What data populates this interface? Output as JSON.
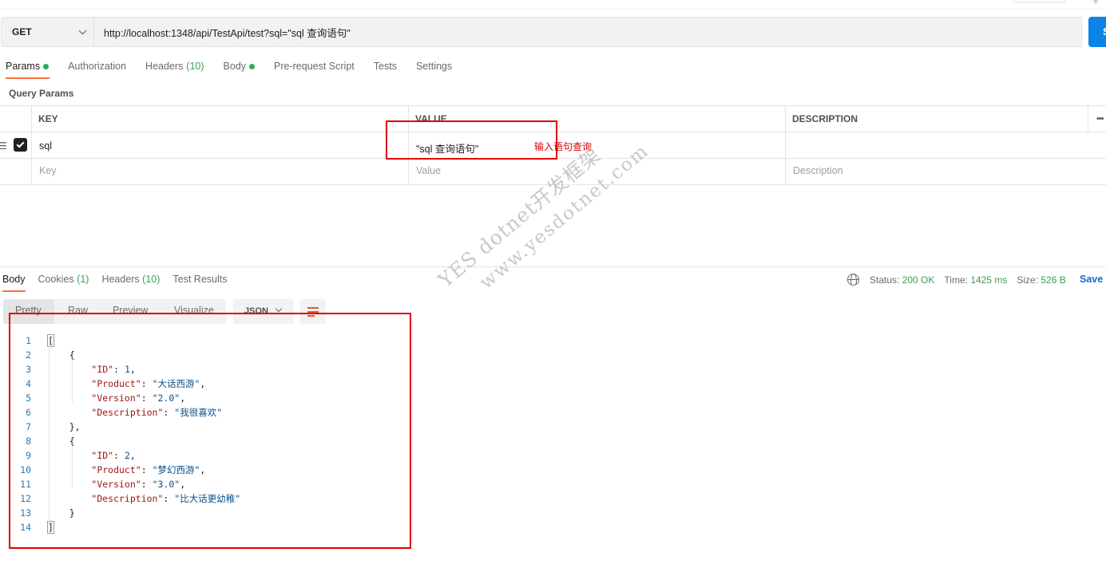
{
  "request": {
    "method": "GET",
    "url": "http://localhost:1348/api/TestApi/test?sql=\"sql 查询语句\"",
    "send_label": "S"
  },
  "request_tabs": [
    {
      "label": "Params",
      "count": "",
      "dot": true,
      "active": true
    },
    {
      "label": "Authorization",
      "count": "",
      "dot": false,
      "active": false
    },
    {
      "label": "Headers",
      "count": "(10)",
      "dot": false,
      "active": false
    },
    {
      "label": "Body",
      "count": "",
      "dot": true,
      "active": false
    },
    {
      "label": "Pre-request Script",
      "count": "",
      "dot": false,
      "active": false
    },
    {
      "label": "Tests",
      "count": "",
      "dot": false,
      "active": false
    },
    {
      "label": "Settings",
      "count": "",
      "dot": false,
      "active": false
    }
  ],
  "query_params": {
    "title": "Query Params",
    "headers": {
      "key": "KEY",
      "value": "VALUE",
      "description": "DESCRIPTION"
    },
    "rows": [
      {
        "key": "sql",
        "value": "\"sql 查询语句\"",
        "description": "",
        "checked": true
      }
    ],
    "placeholders": {
      "key": "Key",
      "value": "Value",
      "description": "Description"
    },
    "more_icon": "more-horizontal-icon"
  },
  "annotation": "输入语句查询",
  "response": {
    "tabs": [
      {
        "label": "Body",
        "count": "",
        "active": true
      },
      {
        "label": "Cookies",
        "count": "(1)",
        "active": false
      },
      {
        "label": "Headers",
        "count": "(10)",
        "active": false
      },
      {
        "label": "Test Results",
        "count": "",
        "active": false
      }
    ],
    "status_label": "Status:",
    "status": "200 OK",
    "time_label": "Time:",
    "time": "1425 ms",
    "size_label": "Size:",
    "size": "526 B",
    "save_label": "Save R",
    "formats": [
      "Pretty",
      "Raw",
      "Preview",
      "Visualize"
    ],
    "language": "JSON",
    "code_lines": [
      {
        "n": "1"
      },
      {
        "n": "2"
      },
      {
        "n": "3"
      },
      {
        "n": "4"
      },
      {
        "n": "5"
      },
      {
        "n": "6"
      },
      {
        "n": "7"
      },
      {
        "n": "8"
      },
      {
        "n": "9"
      },
      {
        "n": "10"
      },
      {
        "n": "11"
      },
      {
        "n": "12"
      },
      {
        "n": "13"
      },
      {
        "n": "14"
      }
    ],
    "body": [
      {
        "ID": 1,
        "Product": "大话西游",
        "Version": "2.0",
        "Description": "我很喜欢"
      },
      {
        "ID": 2,
        "Product": "梦幻西游",
        "Version": "3.0",
        "Description": "比大话更幼稚"
      }
    ]
  },
  "watermark": {
    "line1": "YES dotnet开发框架",
    "line2": "www.yesdotnet.com"
  },
  "colors": {
    "accent": "#ff6c37",
    "send": "#0a84e6",
    "highlight_box": "#e00000",
    "status_ok": "#3a9f4f"
  }
}
